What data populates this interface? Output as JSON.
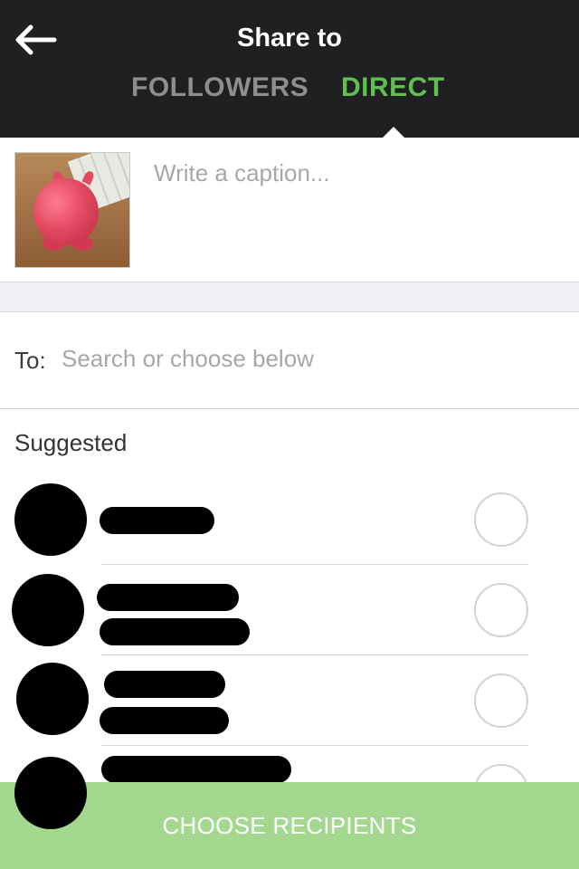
{
  "header": {
    "title": "Share to",
    "back_icon": "arrow-left-icon",
    "tabs": [
      {
        "label": "FOLLOWERS",
        "active": false
      },
      {
        "label": "DIRECT",
        "active": true
      }
    ]
  },
  "caption": {
    "placeholder": "Write a caption..."
  },
  "to_field": {
    "label": "To:",
    "placeholder": "Search or choose below"
  },
  "suggested": {
    "title": "Suggested",
    "rows": [
      {
        "redacted": true,
        "selected": false
      },
      {
        "redacted": true,
        "selected": false
      },
      {
        "redacted": true,
        "selected": false
      },
      {
        "redacted": true,
        "selected": false
      }
    ]
  },
  "footer": {
    "button_label": "CHOOSE RECIPIENTS"
  },
  "colors": {
    "header_bg": "#1f2021",
    "active_tab": "#5fc04f",
    "inactive_tab": "#8d8e90",
    "button_bg": "#a3d88e"
  }
}
